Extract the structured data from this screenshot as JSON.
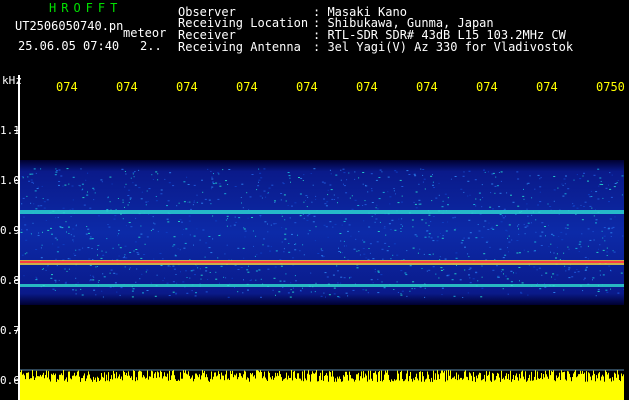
{
  "header": {
    "logo": "HROFFT",
    "filename": "UT2506050740.pn",
    "type_label": "meteor",
    "datetime": "25.06.05 07:40",
    "count": "2..",
    "fields": [
      {
        "label": "Observer",
        "value": ": Masaki Kano"
      },
      {
        "label": "Receiving Location",
        "value": ": Shibukawa, Gunma, Japan"
      },
      {
        "label": "Receiver",
        "value": ": RTL-SDR SDR# 43dB L15 103.2MHz CW"
      },
      {
        "label": "Receiving Antenna",
        "value": ": 3el Yagi(V) Az 330 for Vladivostok"
      }
    ]
  },
  "axis": {
    "unit": "kHz",
    "y_ticks": [
      "1.1",
      "1.0",
      "0.9",
      "0.8",
      "0.7",
      "0.6"
    ],
    "x_ticks": [
      "074",
      "074",
      "074",
      "074",
      "074",
      "074",
      "074",
      "074",
      "074",
      "0750"
    ]
  },
  "colors": {
    "background": "#000000",
    "axis_labels": "#ffff00",
    "logo": "#00e000",
    "amplitude": "#ffff00"
  }
}
